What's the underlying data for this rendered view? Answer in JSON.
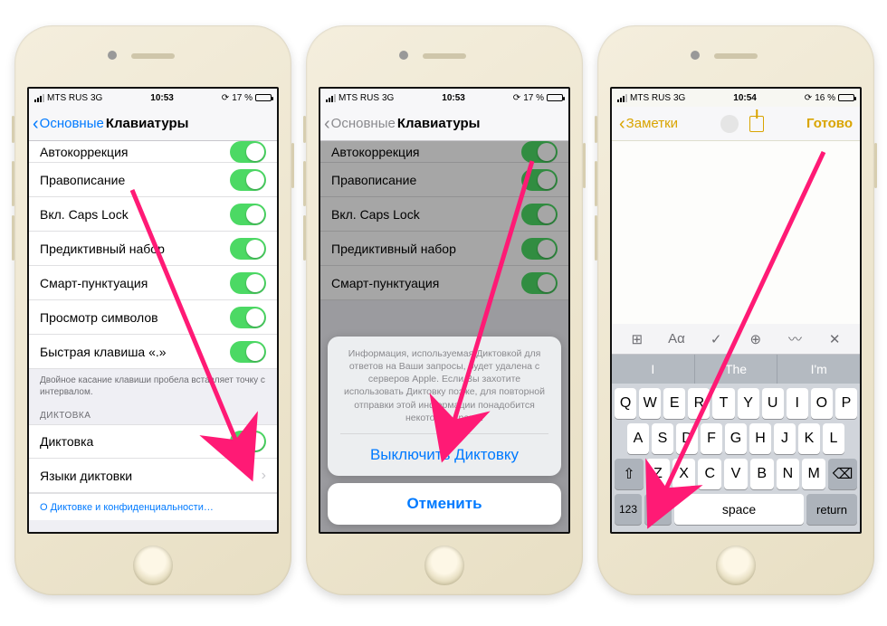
{
  "phone1": {
    "statusbar": {
      "carrier": "MTS RUS",
      "net": "3G",
      "time": "10:53",
      "battery": "17 %"
    },
    "nav": {
      "back": "Основные",
      "title": "Клавиатуры"
    },
    "rows": {
      "autocorrect": "Автокоррекция",
      "spelling": "Правописание",
      "capslock": "Вкл. Caps Lock",
      "predictive": "Предиктивный набор",
      "smartpunct": "Смарт-пунктуация",
      "charpreview": "Просмотр символов",
      "shortcut": "Быстрая клавиша «.»"
    },
    "hint": "Двойное касание клавиши пробела вставляет точку с интервалом.",
    "section": "ДИКТОВКА",
    "dictation": "Диктовка",
    "langs": "Языки диктовки",
    "privacy": "О Диктовке и конфиденциальности…"
  },
  "phone2": {
    "statusbar": {
      "carrier": "MTS RUS",
      "net": "3G",
      "time": "10:53",
      "battery": "17 %"
    },
    "nav": {
      "back": "Основные",
      "title": "Клавиатуры"
    },
    "sheet": {
      "message": "Информация, используемая Диктовкой для ответов на Ваши запросы, будет удалена с серверов Apple. Если Вы захотите использовать Диктовку позже, для повторной отправки этой информации понадобится некоторое время.",
      "action": "Выключить Диктовку",
      "cancel": "Отменить"
    }
  },
  "phone3": {
    "statusbar": {
      "carrier": "MTS RUS",
      "net": "3G",
      "time": "10:54",
      "battery": "16 %"
    },
    "nav": {
      "back": "Заметки",
      "done": "Готово"
    },
    "suggestions": {
      "s1": "I",
      "s2": "The",
      "s3": "I'm"
    },
    "keyboard": {
      "r1": [
        "Q",
        "W",
        "E",
        "R",
        "T",
        "Y",
        "U",
        "I",
        "O",
        "P"
      ],
      "r2": [
        "A",
        "S",
        "D",
        "F",
        "G",
        "H",
        "J",
        "K",
        "L"
      ],
      "r3": [
        "Z",
        "X",
        "C",
        "V",
        "B",
        "N",
        "M"
      ],
      "num": "123",
      "space": "space",
      "return": "return"
    }
  }
}
